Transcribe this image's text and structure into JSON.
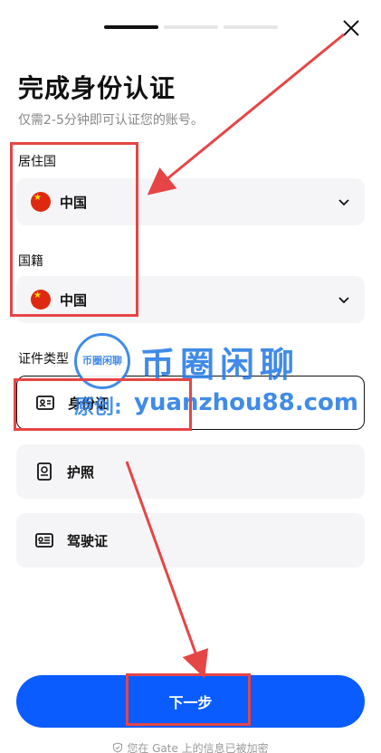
{
  "header": {
    "progress_steps": 3,
    "progress_active": 1
  },
  "title": "完成身份认证",
  "subtitle": "仅需2-5分钟即可认证您的账号。",
  "residence": {
    "label": "居住国",
    "value": "中国",
    "flag": "china-flag"
  },
  "nationality": {
    "label": "国籍",
    "value": "中国",
    "flag": "china-flag"
  },
  "id_type": {
    "label": "证件类型",
    "options": [
      {
        "label": "身份证",
        "icon": "id-card-icon",
        "selected": true
      },
      {
        "label": "护照",
        "icon": "passport-icon",
        "selected": false
      },
      {
        "label": "驾驶证",
        "icon": "drivers-license-icon",
        "selected": false
      }
    ]
  },
  "next_button": "下一步",
  "footer": "您在 Gate 上的信息已被加密",
  "watermark": {
    "logo_text": "币圈闲聊",
    "name": "币圈闲聊",
    "prefix": "原创:",
    "url": "yuanzhou88.com"
  },
  "colors": {
    "primary": "#0a5cff",
    "annotation": "#e64545",
    "watermark": "#2d7fe6"
  }
}
